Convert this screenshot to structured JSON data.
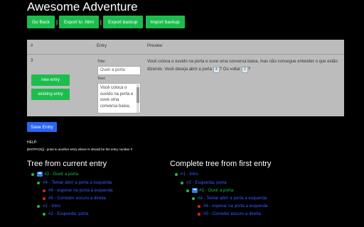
{
  "app": {
    "title": "Awesome Adventure"
  },
  "toolbar": {
    "go_back": "Go Back",
    "export_html": "Export to .html",
    "export_backup": "Export backup",
    "import_backup": "Import backup",
    "separator": "|"
  },
  "table": {
    "headers": {
      "num": "#",
      "entry": "Entry",
      "preview": "Preview"
    },
    "row": {
      "num": "3",
      "new_entry": "new entry",
      "existing_entry": "existing entry",
      "title_label": "Title:",
      "title_value": "Ouvir a porta",
      "text_label": "Text:",
      "text_value": "Você coloca o ouvido na porta e ouve uma conversa baixa,",
      "preview_part1": "Você coloca o ouvido na porta e ouve uma conversa baixa, mas não consegue entender o que estão dizendo. Você deseja abrir a porta",
      "preview_box1": "4",
      "preview_part2": "? Ou voltar",
      "preview_box2": "1",
      "preview_part3": "?"
    }
  },
  "save_button": "Save Entry",
  "help": {
    "title": "HELP:",
    "text": "[ENTRY(N)] - point to another entry where N should be the entry number #"
  },
  "tree_current": {
    "heading": "Tree from current entry",
    "items": [
      {
        "text": "#3 - Ouvir a porta",
        "dot": "green",
        "arrow": true,
        "color": "green"
      },
      {
        "text": "#4 - Tentar abrir a porta a esquerda",
        "dot": "green",
        "arrow": false,
        "color": "blue"
      },
      {
        "text": "#6 - esperar na porta a esquerda",
        "dot": "red",
        "arrow": false,
        "color": "blue"
      },
      {
        "text": "#5 - Corredor escuro a direita",
        "dot": "red",
        "arrow": false,
        "color": "blue"
      },
      {
        "text": "#1 - Intro",
        "dot": "green",
        "arrow": false,
        "color": "blue"
      },
      {
        "text": "#2 - Esquerda, porta",
        "dot": "green",
        "arrow": false,
        "color": "blue"
      }
    ]
  },
  "tree_complete": {
    "heading": "Complete tree from first entry",
    "items": [
      {
        "text": "#1 - Intro",
        "dot": "green",
        "arrow": false,
        "color": "blue"
      },
      {
        "text": "#2 - Esquerda, porta",
        "dot": "green",
        "arrow": false,
        "color": "blue"
      },
      {
        "text": "#3 - Ouvir a porta",
        "dot": "green",
        "arrow": true,
        "color": "green"
      },
      {
        "text": "#4 - Tentar abrir a porta a esquerda",
        "dot": "green",
        "arrow": false,
        "color": "blue"
      },
      {
        "text": "#6 - esperar na porta a esquerda",
        "dot": "red",
        "arrow": false,
        "color": "blue"
      },
      {
        "text": "#5 - Corredor escuro a direita",
        "dot": "red",
        "arrow": false,
        "color": "blue"
      }
    ]
  },
  "colors": {
    "accent_green": "#1cbd4d",
    "accent_blue": "#2965f1",
    "link_blue": "#3b5bff",
    "dot_red": "#e52222"
  }
}
